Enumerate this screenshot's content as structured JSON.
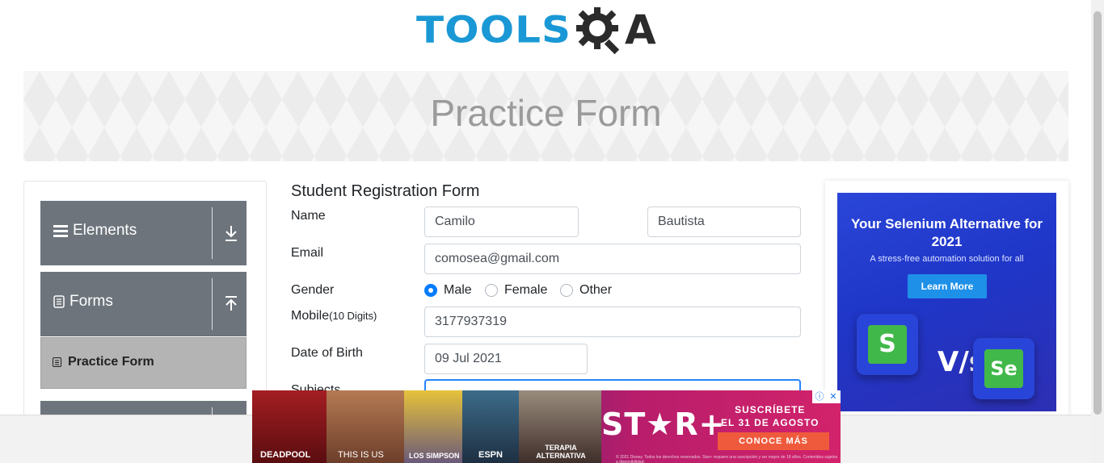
{
  "header": {
    "logo_left": "TOOLS",
    "logo_right": "A",
    "page_title": "Practice Form"
  },
  "sidebar": {
    "groups": [
      {
        "label": "Elements",
        "icon": "hamburger-icon",
        "toggle": "download-arrow-icon"
      },
      {
        "label": "Forms",
        "icon": "document-icon",
        "toggle": "upload-arrow-icon"
      }
    ],
    "active_item": {
      "label": "Practice Form",
      "icon": "list-icon"
    }
  },
  "form": {
    "title": "Student Registration Form",
    "name_label": "Name",
    "first_name": "Camilo",
    "last_name": "Bautista",
    "email_label": "Email",
    "email": "comosea@gmail.com",
    "gender_label": "Gender",
    "gender_options": [
      "Male",
      "Female",
      "Other"
    ],
    "gender_selected": "Male",
    "mobile_label": "Mobile",
    "mobile_hint": "(10 Digits)",
    "mobile": "3177937319",
    "dob_label": "Date of Birth",
    "dob": "09 Jul 2021",
    "subjects_label": "Subjects"
  },
  "ad_right": {
    "headline": "Your Selenium Alternative for 2021",
    "subline": "A stress-free automation solution for all",
    "button": "Learn More",
    "vs_text": "V/s",
    "left_tile_letter": "S",
    "right_tile_text": "Se",
    "colors": {
      "background": "#2a46d8",
      "button": "#1e90e8",
      "tile_green": "#41b84a"
    }
  },
  "ad_bottom": {
    "captions": [
      "DEADPOOL",
      "THIS IS US",
      "LOS SIMPSON",
      "ESPN",
      "TERAPIA ALTERNATIVA"
    ],
    "brand": "ST★R+",
    "subscribe_line1": "SUSCRÍBETE",
    "subscribe_line2": "EL 31 DE AGOSTO",
    "cta": "CONOCE MÁS",
    "fine_print": "© 2021 Disney. Todos los derechos reservados. Star+ requiere una suscripción y ser mayor de 18 años. Contenidos sujetos a disponibilidad."
  },
  "colors": {
    "brand_blue": "#1a98d5",
    "sidebar_group": "#6d747c",
    "active_item": "#b4b4b4",
    "radio_selected": "#007bff"
  }
}
